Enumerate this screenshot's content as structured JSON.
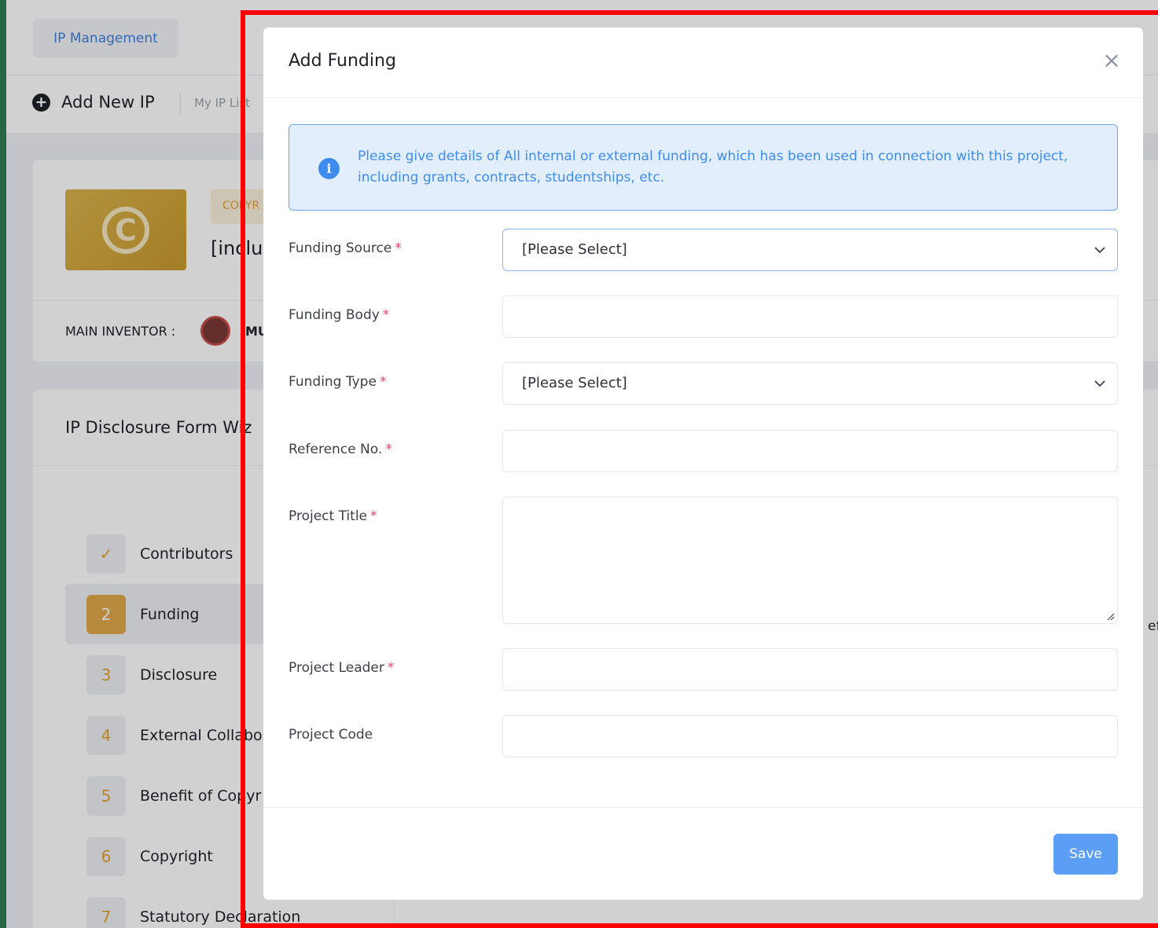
{
  "app": {
    "crumb_button": "IP Management",
    "add_new_ip": "Add New IP",
    "my_ip_list": "My IP List",
    "ip_badge": "COPYR",
    "ip_title_fragment": "[inclu",
    "main_inventor_label": "MAIN INVENTOR :",
    "main_inventor_fragment": "MU",
    "wizard_title": "IP Disclosure Form Wiz",
    "right_fragment": "efe",
    "steps": [
      {
        "num": "✓",
        "label": "Contributors",
        "state": "done"
      },
      {
        "num": "2",
        "label": "Funding",
        "state": "active"
      },
      {
        "num": "3",
        "label": "Disclosure",
        "state": "pending"
      },
      {
        "num": "4",
        "label": "External Collabo",
        "state": "pending"
      },
      {
        "num": "5",
        "label": "Benefit of Copyr",
        "state": "pending"
      },
      {
        "num": "6",
        "label": "Copyright",
        "state": "pending"
      },
      {
        "num": "7",
        "label": "Statutory Declaration",
        "state": "pending"
      }
    ]
  },
  "modal": {
    "title": "Add Funding",
    "close_icon": "close-icon",
    "info_icon": "info-icon",
    "info_text": "Please give details of All internal or external funding, which has been used in connection with this project, including grants, contracts, studentships, etc.",
    "required_marker": "*",
    "fields": {
      "funding_source": {
        "label": "Funding Source",
        "value": "[Please Select]",
        "required": true
      },
      "funding_body": {
        "label": "Funding Body",
        "value": "",
        "required": true
      },
      "funding_type": {
        "label": "Funding Type",
        "value": "[Please Select]",
        "required": true
      },
      "reference_no": {
        "label": "Reference No.",
        "value": "",
        "required": true
      },
      "project_title": {
        "label": "Project Title",
        "value": "",
        "required": true
      },
      "project_leader": {
        "label": "Project Leader",
        "value": "",
        "required": true
      },
      "project_code": {
        "label": "Project Code",
        "value": "",
        "required": false
      }
    },
    "save_label": "Save"
  },
  "colors": {
    "accent": "#5b9ef5",
    "info_text": "#3e8cf0",
    "highlight": "#ff0000",
    "required": "#f1416c",
    "step_active": "#e0a94b"
  }
}
